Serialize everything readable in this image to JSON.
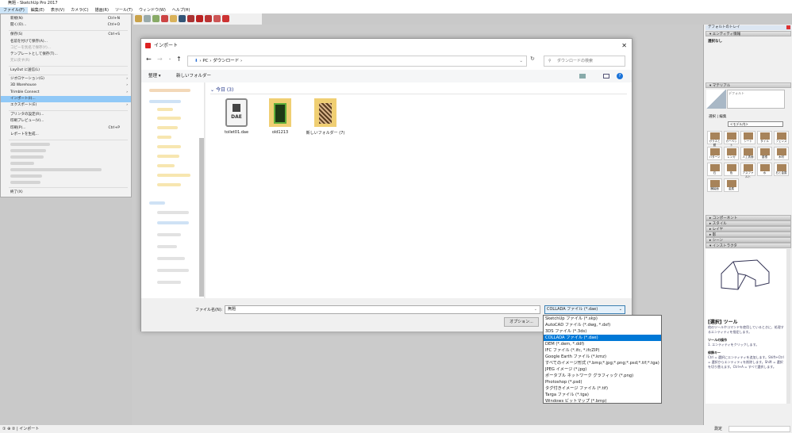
{
  "window": {
    "title": "無題 - SketchUp Pro 2017"
  },
  "menubar": [
    "ファイル(F)",
    "編集(E)",
    "表示(V)",
    "カメラ(C)",
    "描画(R)",
    "ツール(T)",
    "ウィンドウ(W)",
    "ヘルプ(H)"
  ],
  "file_menu": [
    {
      "label": "新規(N)",
      "shortcut": "Ctrl+N"
    },
    {
      "label": "開く(O)...",
      "shortcut": "Ctrl+O"
    },
    {
      "label": "保存(S)",
      "shortcut": "Ctrl+S"
    },
    {
      "label": "名前を付けて保存(A)..."
    },
    {
      "label": "コピーを別名で保存(Y)..."
    },
    {
      "label": "テンプレートとして保存(T)..."
    },
    {
      "label": "元に戻す(R)"
    },
    {
      "label": "LayOut に送信(L)"
    },
    {
      "label": "ジオロケーション(G)",
      "submenu": true
    },
    {
      "label": "3D Warehouse",
      "submenu": true
    },
    {
      "label": "Trimble Connect",
      "submenu": true
    },
    {
      "label": "インポート(I)...",
      "highlighted": true
    },
    {
      "label": "エクスポート(E)",
      "submenu": true
    },
    {
      "label": "プリンタの設定(R)..."
    },
    {
      "label": "印刷プレビュー(V)..."
    },
    {
      "label": "印刷(P)...",
      "shortcut": "Ctrl+P"
    },
    {
      "label": "レポートを生成..."
    },
    {
      "label": "終了(X)"
    }
  ],
  "dialog": {
    "title": "インポート",
    "breadcrumb": [
      "PC",
      "ダウンロード"
    ],
    "search_placeholder": "ダウンロードの検索",
    "organize": "整理 ▾",
    "new_folder": "新しいフォルダー",
    "group": "今日 (3)",
    "files": [
      {
        "name": "toilet01.dae",
        "badge": "DAE"
      },
      {
        "name": "old1213"
      },
      {
        "name": "新しいフォルダー (7)"
      }
    ],
    "filename_label": "ファイル名(N):",
    "filename_value": "無題",
    "filetype_value": "COLLADA ファイル (*.dae)",
    "options_button": "オプション..."
  },
  "filetype_options": [
    "SketchUp ファイル (*.skp)",
    "AutoCAD ファイル (*.dwg, *.dxf)",
    "3DS ファイル (*.3ds)",
    "COLLADA ファイル (*.dae)",
    "DEM (*.dem, *.ddf)",
    "IFC ファイル (*.ifc, *.ifcZIP)",
    "Google Earth ファイル (*.kmz)",
    "すべてのイメージ形式 (*.bmp;*.jpg;*.png;*.psd;*.tif;*.tga)",
    "JPEG イメージ (*.jpg)",
    "ポータブル ネットワーク グラフィック (*.png)",
    "Photoshop (*.psd)",
    "タグ付きイメージ ファイル (*.tif)",
    "Targa ファイル (*.tga)",
    "Windows ビットマップ (*.bmp)"
  ],
  "selected_filetype_index": 3,
  "right_panel": {
    "tray_title": "デフォルトのトレイ",
    "entity_info": "エンティティ情報",
    "entity_value": "選択なし",
    "materials": "マテリアル",
    "material_name": "デフォルト",
    "tabs": [
      "選択",
      "編集"
    ],
    "library": "<モデル内>",
    "material_swatches": [
      "ガラスと鏡",
      "カーペット",
      "シート",
      "タイル",
      "フェンス",
      "パターン",
      "レンガ",
      "人工表面",
      "屋根",
      "木材",
      "石",
      "色",
      "アスファルト",
      "水",
      "石と金属",
      "舗装面",
      "金属"
    ],
    "collapsed_panels": [
      "コンポーネント",
      "スタイル",
      "レイヤ",
      "影",
      "シーン",
      "インストラクタ"
    ],
    "instructor_title": "[選択] ツール",
    "instructor_text": "他のツールやコマンドを使用しているときに、処理するエンティティを指定します。",
    "tool_ops_title": "ツールの操作",
    "tool_ops_text": "1. エンティティをクリックします。",
    "modifier_title": "修飾キー",
    "modifier_text": "Ctrl = 選択にエンティティを追加します。Shift+Ctrl = 選択からエンティティを削除します。Shift = 選択を切り替えます。Ctrl+A = すべて選択します。",
    "measurement_label": "測定"
  },
  "status": {
    "text": "インポート"
  }
}
